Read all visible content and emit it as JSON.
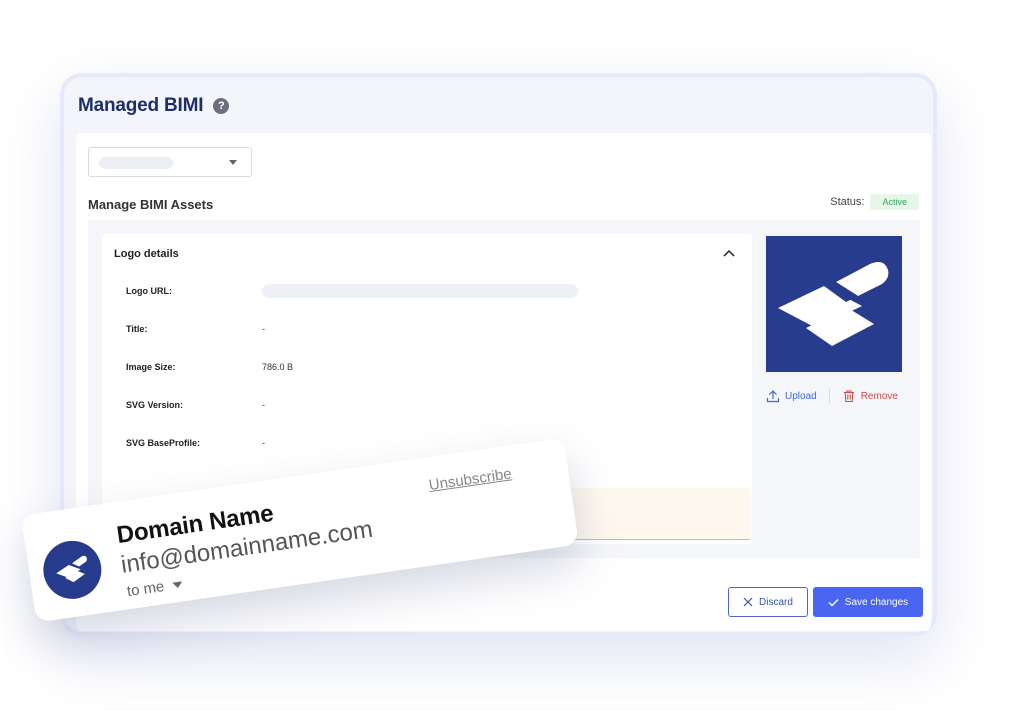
{
  "header": {
    "title": "Managed BIMI",
    "help_icon": "?"
  },
  "section": {
    "title": "Manage BIMI Assets",
    "status_label": "Status:",
    "status_value": "Active"
  },
  "logo_details": {
    "header": "Logo details",
    "rows": [
      {
        "label": "Logo URL:",
        "value": ""
      },
      {
        "label": "Title:",
        "value": "-"
      },
      {
        "label": "Image Size:",
        "value": "786.0 B"
      },
      {
        "label": "SVG Version:",
        "value": "-"
      },
      {
        "label": "SVG BaseProfile:",
        "value": "-"
      }
    ]
  },
  "asset_actions": {
    "upload_label": "Upload",
    "remove_label": "Remove"
  },
  "footer": {
    "discard_label": "Discard",
    "save_label": "Save changes"
  },
  "email_preview": {
    "sender_name": "Domain Name",
    "sender_email": "info@domainname.com",
    "recipient": "to me",
    "unsubscribe_label": "Unsubscribe"
  },
  "colors": {
    "brand_navy": "#283c8e",
    "title_navy": "#1f2d6b",
    "primary_blue": "#4a66f0",
    "status_green": "#37a45a",
    "remove_red": "#d24646"
  }
}
